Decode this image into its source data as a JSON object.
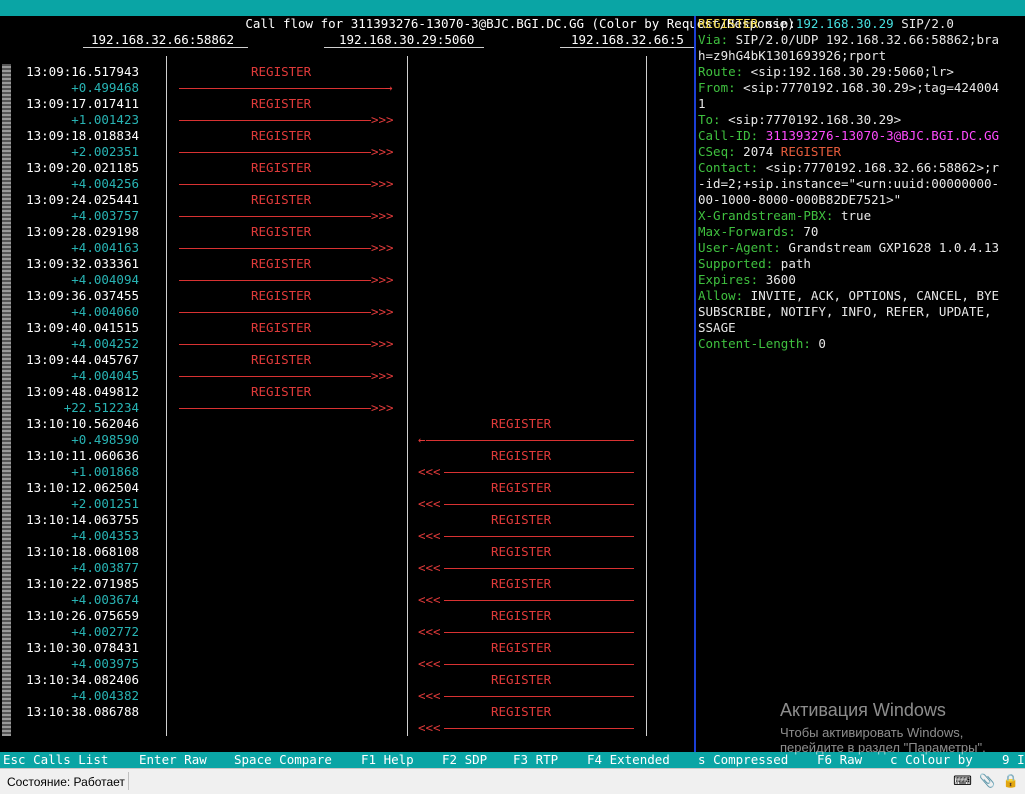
{
  "title": "Call flow for 311393276-13070-3@BJC.BGI.DC.GG (Color by Request/Response)",
  "hosts": [
    "192.168.32.66:58862",
    "192.168.30.29:5060",
    "192.168.32.66:5"
  ],
  "arrow_heads": {
    "right_single": "→",
    "right_multi": ">>>",
    "left_single": "←",
    "left_multi": "<<<"
  },
  "flow": [
    {
      "time": "13:09:16.517943",
      "delta": "+0.499468",
      "label": "REGISTER",
      "dir": "right",
      "retrans": false
    },
    {
      "time": "13:09:17.017411",
      "delta": "+1.001423",
      "label": "REGISTER",
      "dir": "right",
      "retrans": true
    },
    {
      "time": "13:09:18.018834",
      "delta": "+2.002351",
      "label": "REGISTER",
      "dir": "right",
      "retrans": true
    },
    {
      "time": "13:09:20.021185",
      "delta": "+4.004256",
      "label": "REGISTER",
      "dir": "right",
      "retrans": true
    },
    {
      "time": "13:09:24.025441",
      "delta": "+4.003757",
      "label": "REGISTER",
      "dir": "right",
      "retrans": true
    },
    {
      "time": "13:09:28.029198",
      "delta": "+4.004163",
      "label": "REGISTER",
      "dir": "right",
      "retrans": true
    },
    {
      "time": "13:09:32.033361",
      "delta": "+4.004094",
      "label": "REGISTER",
      "dir": "right",
      "retrans": true
    },
    {
      "time": "13:09:36.037455",
      "delta": "+4.004060",
      "label": "REGISTER",
      "dir": "right",
      "retrans": true
    },
    {
      "time": "13:09:40.041515",
      "delta": "+4.004252",
      "label": "REGISTER",
      "dir": "right",
      "retrans": true
    },
    {
      "time": "13:09:44.045767",
      "delta": "+4.004045",
      "label": "REGISTER",
      "dir": "right",
      "retrans": true
    },
    {
      "time": "13:09:48.049812",
      "delta": "+22.512234",
      "label": "REGISTER",
      "dir": "right",
      "retrans": true
    },
    {
      "time": "13:10:10.562046",
      "delta": "+0.498590",
      "label": "REGISTER",
      "dir": "left",
      "retrans": false
    },
    {
      "time": "13:10:11.060636",
      "delta": "+1.001868",
      "label": "REGISTER",
      "dir": "left",
      "retrans": true
    },
    {
      "time": "13:10:12.062504",
      "delta": "+2.001251",
      "label": "REGISTER",
      "dir": "left",
      "retrans": true
    },
    {
      "time": "13:10:14.063755",
      "delta": "+4.004353",
      "label": "REGISTER",
      "dir": "left",
      "retrans": true
    },
    {
      "time": "13:10:18.068108",
      "delta": "+4.003877",
      "label": "REGISTER",
      "dir": "left",
      "retrans": true
    },
    {
      "time": "13:10:22.071985",
      "delta": "+4.003674",
      "label": "REGISTER",
      "dir": "left",
      "retrans": true
    },
    {
      "time": "13:10:26.075659",
      "delta": "+4.002772",
      "label": "REGISTER",
      "dir": "left",
      "retrans": true
    },
    {
      "time": "13:10:30.078431",
      "delta": "+4.003975",
      "label": "REGISTER",
      "dir": "left",
      "retrans": true
    },
    {
      "time": "13:10:34.082406",
      "delta": "+4.004382",
      "label": "REGISTER",
      "dir": "left",
      "retrans": true
    },
    {
      "time": "13:10:38.086788",
      "delta": "",
      "label": "REGISTER",
      "dir": "left",
      "retrans": true
    }
  ],
  "detail": [
    [
      [
        "REGISTER",
        "dy"
      ],
      [
        " sip:",
        "dv"
      ],
      [
        "192.168.30.29",
        "dc"
      ],
      [
        " SIP/2.0",
        "dv"
      ]
    ],
    [
      [
        "Via:",
        "dh"
      ],
      [
        " SIP/2.0/UDP 192.168.32.66:58862;bra",
        "dv"
      ]
    ],
    [
      [
        "h=z9hG4bK1301693926;rport",
        "dv"
      ]
    ],
    [
      [
        "Route:",
        "dh"
      ],
      [
        " <sip:192.168.30.29:5060;lr>",
        "dv"
      ]
    ],
    [
      [
        "From:",
        "dh"
      ],
      [
        " <sip:7770192.168.30.29>;tag=424004",
        "dv"
      ]
    ],
    [
      [
        "1",
        "dv"
      ]
    ],
    [
      [
        "To:",
        "dh"
      ],
      [
        " <sip:7770192.168.30.29>",
        "dv"
      ]
    ],
    [
      [
        "Call-ID:",
        "dh"
      ],
      [
        " 311393276-13070-3@BJC.BGI.DC.GG",
        "dm"
      ]
    ],
    [
      [
        "CSeq:",
        "dh"
      ],
      [
        " 2074 ",
        "dv"
      ],
      [
        "REGISTER",
        "dr"
      ]
    ],
    [
      [
        "Contact:",
        "dh"
      ],
      [
        " <sip:7770192.168.32.66:58862>;r",
        "dv"
      ]
    ],
    [
      [
        "-id=2;+sip.instance=\"<urn:uuid:00000000-",
        "dv"
      ]
    ],
    [
      [
        "00-1000-8000-000B82DE7521>\"",
        "dv"
      ]
    ],
    [
      [
        "X-Grandstream-PBX:",
        "dh"
      ],
      [
        " true",
        "dv"
      ]
    ],
    [
      [
        "Max-Forwards:",
        "dh"
      ],
      [
        " 70",
        "dv"
      ]
    ],
    [
      [
        "User-Agent:",
        "dh"
      ],
      [
        " Grandstream GXP1628 1.0.4.13",
        "dv"
      ]
    ],
    [
      [
        "Supported:",
        "dh"
      ],
      [
        " path",
        "dv"
      ]
    ],
    [
      [
        "Expires:",
        "dh"
      ],
      [
        " 3600",
        "dv"
      ]
    ],
    [
      [
        "Allow:",
        "dh"
      ],
      [
        " INVITE, ACK, OPTIONS, CANCEL, BYE",
        "dv"
      ]
    ],
    [
      [
        "SUBSCRIBE, NOTIFY, INFO, REFER, UPDATE,",
        "dv"
      ]
    ],
    [
      [
        "SSAGE",
        "dv"
      ]
    ],
    [
      [
        "Content-Length:",
        "dh"
      ],
      [
        " 0",
        "dv"
      ]
    ]
  ],
  "keys": [
    {
      "key": "Esc",
      "desc": "Calls List"
    },
    {
      "key": "Enter",
      "desc": "Raw"
    },
    {
      "key": "Space",
      "desc": "Compare"
    },
    {
      "key": "F1",
      "desc": "Help"
    },
    {
      "key": "F2",
      "desc": "SDP"
    },
    {
      "key": "F3",
      "desc": "RTP"
    },
    {
      "key": "F4",
      "desc": "Extended"
    },
    {
      "key": "s",
      "desc": "Compressed"
    },
    {
      "key": "F6",
      "desc": "Raw"
    },
    {
      "key": "c",
      "desc": "Colour by"
    },
    {
      "key": "9",
      "desc": "I"
    }
  ],
  "status": {
    "text": "Состояние: Работает"
  },
  "watermark": {
    "title": "Активация Windows",
    "line1": "Чтобы активировать Windows,",
    "line2": "перейдите в раздел \"Параметры\"."
  },
  "colors": {
    "teal_bar": "#0aa5a5",
    "request_red": "#e03a3a",
    "delta_teal": "#28b4b4",
    "header_green": "#3fc03f",
    "panel_divider": "#1b3fd6"
  }
}
